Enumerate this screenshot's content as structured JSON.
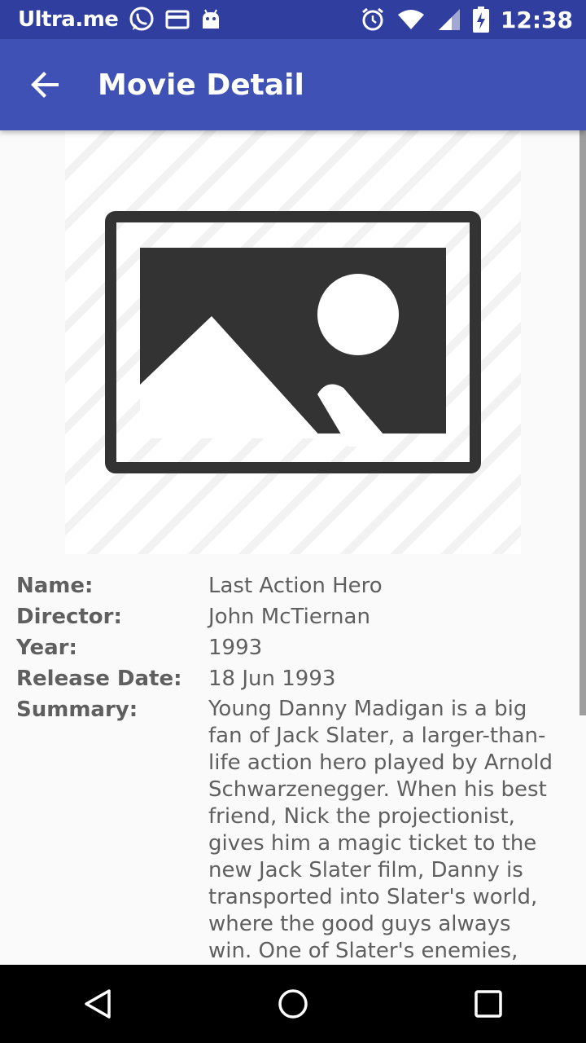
{
  "status_bar": {
    "carrier": "Ultra.me",
    "time": "12:38",
    "icons": [
      "whatsapp-icon",
      "card-icon",
      "android-icon",
      "alarm-icon",
      "wifi-icon",
      "signal-icon",
      "battery-charging-icon"
    ]
  },
  "app_bar": {
    "title": "Movie Detail",
    "back_icon": "arrow-back-icon"
  },
  "poster": {
    "icon": "image-placeholder-icon"
  },
  "details": {
    "name_label": "Name:",
    "name_value": "Last Action Hero",
    "director_label": "Director:",
    "director_value": "John McTiernan",
    "year_label": "Year:",
    "year_value": "1993",
    "release_label": "Release Date:",
    "release_value": "18 Jun 1993",
    "summary_label": "Summary:",
    "summary_value": "Young Danny Madigan is a big fan of Jack Slater, a larger-than-life action hero played by Arnold Schwarzenegger. When his best friend, Nick the projectionist, gives him a magic ticket to the new Jack Slater film, Danny is transported into Slater's world, where the good guys always win. One of Slater's enemies, Benedict the hitman, gets"
  },
  "nav_bar": {
    "back": "nav-back-icon",
    "home": "nav-home-icon",
    "recents": "nav-recents-icon"
  },
  "colors": {
    "status_bar": "#303f9f",
    "app_bar": "#3f51b5",
    "background": "#fafafa",
    "text": "#5f5f5f"
  }
}
